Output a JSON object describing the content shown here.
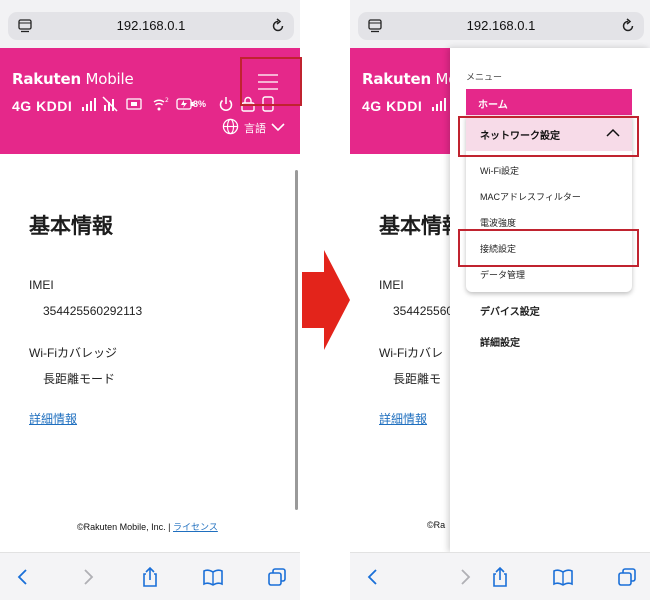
{
  "browser": {
    "url": "192.168.0.1"
  },
  "header": {
    "brand_bold": "Rakuten",
    "brand_light": " Mobile",
    "network": "4G KDDI",
    "battery": "8%",
    "language": "言語"
  },
  "content": {
    "title": "基本情報",
    "imei_label": "IMEI",
    "imei_value": "354425560292113",
    "wifi_label": "Wi-Fiカバレッジ",
    "wifi_value": "長距離モード",
    "detail_link": "詳細情報",
    "footer_copyright": "©Rakuten Mobile, Inc. | ",
    "footer_license": "ライセンス"
  },
  "right_content": {
    "title": "基本情報",
    "imei_label": "IMEI",
    "imei_value": "3544255600",
    "wifi_label": "Wi-Fiカバレ",
    "wifi_value": "長距離モ",
    "detail_link": "詳細情報",
    "footer_copyright": "©Ra"
  },
  "menu": {
    "heading": "メニュー",
    "home": "ホーム",
    "network": "ネットワーク設定",
    "sub_items": [
      "Wi-Fi設定",
      "MACアドレスフィルター",
      "電波強度",
      "接続設定",
      "データ管理"
    ],
    "device": "デバイス設定",
    "advanced": "詳細設定"
  },
  "colors": {
    "brand_pink": "#e5288a",
    "highlight_red": "#c0232f",
    "link_blue": "#1f6fbf",
    "arrow_red": "#e3241b"
  }
}
